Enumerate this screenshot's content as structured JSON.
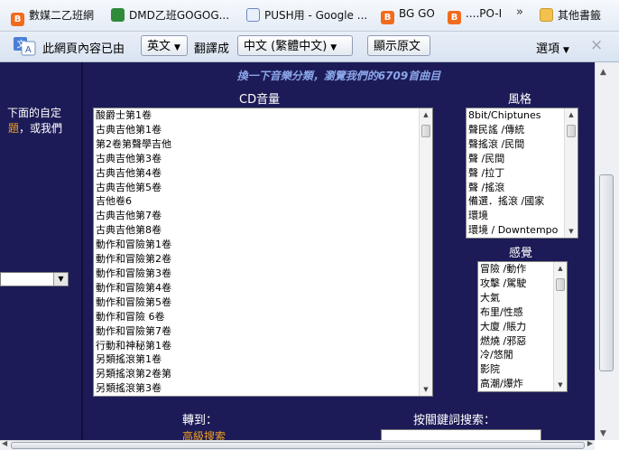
{
  "bookmarks": {
    "items": [
      {
        "label": "數媒二乙班網",
        "icon": "blogger-icon"
      },
      {
        "label": "DMD乙班GOGOG...",
        "icon": "spreadsheet-icon"
      },
      {
        "label": "PUSH用 - Google ...",
        "icon": "document-icon"
      },
      {
        "label": "BG GO",
        "icon": "blogger-icon"
      },
      {
        "label": "....PO-I",
        "icon": "blogger-icon"
      }
    ],
    "overflow": "»",
    "folder_label": "其他書籤"
  },
  "translate_bar": {
    "prefix": "此網頁內容已由",
    "source_lang": "英文",
    "middle": "翻譯成",
    "target_lang": "中文 (繁體中文)",
    "show_original": "顯示原文",
    "options": "選項",
    "close": "×"
  },
  "page": {
    "left_text_1": "下面的自定",
    "left_text_2a": "題",
    "left_text_2b": "，或我們",
    "banner": "換一下音樂分類，瀏覽我們的6709首曲目",
    "cd_title": "CD音量",
    "cd_items": [
      "酸爵士第1卷",
      "古典吉他第1卷",
      "第2卷第聲學吉他",
      "古典吉他第3卷",
      "古典吉他第4卷",
      "古典吉他第5卷",
      "吉他卷6",
      "古典吉他第7卷",
      "古典吉他第8卷",
      "動作和冒險第1卷",
      "動作和冒險第2卷",
      "動作和冒險第3卷",
      "動作和冒險第4卷",
      "動作和冒險第5卷",
      "動作和冒險 6卷",
      "動作和冒險第7卷",
      "行動和神秘第1卷",
      "另類搖滾第1卷",
      "另類搖滾第2卷第",
      "另類搖滾第3卷"
    ],
    "style_title": "風格",
    "style_items": [
      "8bit/Chiptunes",
      "聲民謠 /傳統",
      "聲搖滾 /民間",
      "聲 /民間",
      "聲 /拉丁",
      "聲 /搖滾",
      "備選．搖滾 /國家",
      "環境",
      "環境 / Downtempo"
    ],
    "feel_title": "感覺",
    "feel_items": [
      "冒險 /動作",
      "攻擊 /駕駛",
      "大氣",
      "布里/性感",
      "大廈 /賬力",
      "燃燒 /邪惡",
      "冷/悠閒",
      "影院",
      "高潮/爆炸"
    ],
    "goto_label": "轉到：",
    "advanced_search": "高級搜索",
    "keyword_label": "按關鍵詞搜索："
  },
  "colors": {
    "page_bg": "#1d1b57",
    "banner_text": "#8aa6e8",
    "link_orange": "#f0a020"
  }
}
